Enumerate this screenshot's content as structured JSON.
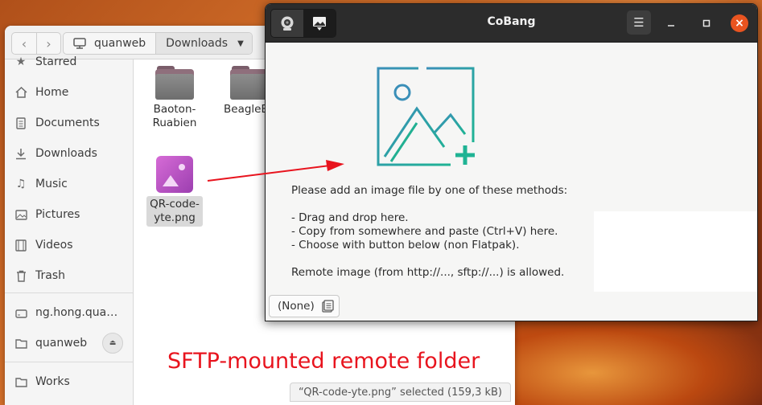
{
  "files": {
    "path": {
      "segment_1": "quanweb",
      "segment_2": "Downloads"
    },
    "sidebar": {
      "items": [
        {
          "label": "Starred",
          "icon": "star-icon"
        },
        {
          "label": "Home",
          "icon": "home-icon"
        },
        {
          "label": "Documents",
          "icon": "document-icon"
        },
        {
          "label": "Downloads",
          "icon": "download-icon"
        },
        {
          "label": "Music",
          "icon": "music-icon"
        },
        {
          "label": "Pictures",
          "icon": "picture-icon"
        },
        {
          "label": "Videos",
          "icon": "video-icon"
        },
        {
          "label": "Trash",
          "icon": "trash-icon"
        },
        {
          "label": "ng.hong.quan...",
          "icon": "drive-icon"
        },
        {
          "label": "quanweb",
          "icon": "network-folder-icon"
        },
        {
          "label": "Works",
          "icon": "folder-icon"
        }
      ]
    },
    "items": [
      {
        "name_line1": "Baoton-",
        "name_line2": "Ruabien"
      },
      {
        "name_line1": "BeagleBo",
        "name_line2": ""
      },
      {
        "name_line1": "QR-code-",
        "name_line2": "yte.png"
      }
    ],
    "status": "“QR-code-yte.png” selected  (159,3 kB)"
  },
  "annotation": {
    "text": "SFTP-mounted remote folder",
    "color": "#e8141e"
  },
  "cobang": {
    "title": "CoBang",
    "instructions": {
      "heading": "Please add an image file by one of these methods:",
      "method_1": "- Drag and drop here.",
      "method_2": "- Copy from somewhere and paste (Ctrl+V) here.",
      "method_3": "- Choose with button below (non Flatpak).",
      "remote": "Remote image (from http://..., sftp://...) is allowed."
    },
    "file_chooser_label": "(None)",
    "accent_color": "#2aa89a",
    "close_color": "#e95420"
  }
}
